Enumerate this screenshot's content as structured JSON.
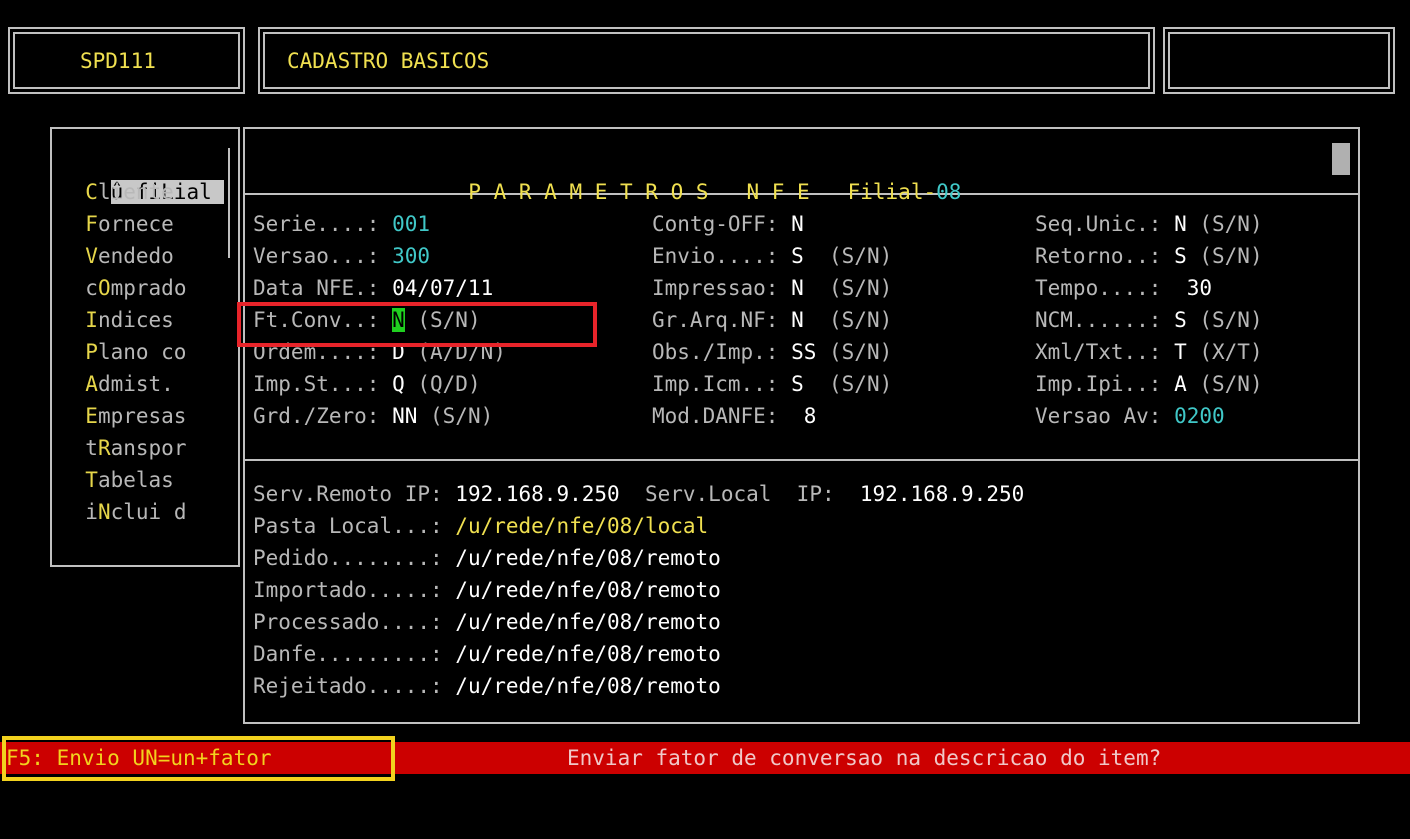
{
  "header": {
    "program_code": "SPD111",
    "title": "CADASTRO BASICOS",
    "right_box": ""
  },
  "menu": {
    "items": [
      {
        "prefix": "û ",
        "hot": "",
        "rest": "fiLial",
        "selected": true
      },
      {
        "prefix": "  ",
        "hot": "C",
        "rest": "liente"
      },
      {
        "prefix": "  ",
        "hot": "F",
        "rest": "ornece"
      },
      {
        "prefix": "  ",
        "hot": "V",
        "rest": "endedo"
      },
      {
        "prefix": "  ",
        "hot": "",
        "rest": "cOmprado"
      },
      {
        "prefix": "  ",
        "hot": "I",
        "rest": "ndices"
      },
      {
        "prefix": "  ",
        "hot": "P",
        "rest": "lano co"
      },
      {
        "prefix": "  ",
        "hot": "A",
        "rest": "dmist."
      },
      {
        "prefix": "  ",
        "hot": "E",
        "rest": "mpresas"
      },
      {
        "prefix": "  ",
        "hot": "",
        "rest": "tRanspor"
      },
      {
        "prefix": "  ",
        "hot": "T",
        "rest": "abelas"
      },
      {
        "prefix": "  ",
        "hot": "",
        "rest": "iNclui d"
      }
    ]
  },
  "panel": {
    "title": "P A R A M E T R O S   N F E",
    "filial_label": "Filial-",
    "filial_value": "08"
  },
  "params": {
    "serie_label": "Serie....: ",
    "serie_value": "001",
    "versao_label": "Versao...: ",
    "versao_value": "300",
    "datanfe_label": "Data NFE.: ",
    "datanfe_value": "04/07/11",
    "ftconv_label": "Ft.Conv..: ",
    "ftconv_value": "N",
    "ftconv_hint": " (S/N)",
    "ordem_label": "Ordem....: ",
    "ordem_value": "D",
    "ordem_hint": " (A/D/N)",
    "impst_label": "Imp.St...: ",
    "impst_value": "Q",
    "impst_hint": " (Q/D)",
    "grdzero_label": "Grd./Zero: ",
    "grdzero_value": "NN",
    "grdzero_hint": " (S/N)",
    "contg_label": "Contg-OFF: ",
    "contg_value": "N",
    "envio_label": "Envio....: ",
    "envio_value": "S",
    "envio_hint": "  (S/N)",
    "impressao_label": "Impressao: ",
    "impressao_value": "N",
    "impressao_hint": "  (S/N)",
    "grarq_label": "Gr.Arq.NF: ",
    "grarq_value": "N",
    "grarq_hint": "  (S/N)",
    "obsimp_label": "Obs./Imp.: ",
    "obsimp_value": "SS",
    "obsimp_hint": " (S/N)",
    "impicm_label": "Imp.Icm..: ",
    "impicm_value": "S",
    "impicm_hint": "  (S/N)",
    "moddanfe_label": "Mod.DANFE:  ",
    "moddanfe_value": "8",
    "sequnic_label": "Seq.Unic.: ",
    "sequnic_value": "N",
    "sequnic_hint": " (S/N)",
    "retorno_label": "Retorno..: ",
    "retorno_value": "S",
    "retorno_hint": " (S/N)",
    "tempo_label": "Tempo....:  ",
    "tempo_value": "30",
    "ncm_label": "NCM......: ",
    "ncm_value": "S",
    "ncm_hint": " (S/N)",
    "xmltxt_label": "Xml/Txt..: ",
    "xmltxt_value": "T",
    "xmltxt_hint": " (X/T)",
    "impipi_label": "Imp.Ipi..: ",
    "impipi_value": "A",
    "impipi_hint": " (S/N)",
    "versaoav_label": "Versao Av: ",
    "versaoav_value": "0200"
  },
  "paths": {
    "serv_remoto_label": "Serv.Remoto IP: ",
    "serv_remoto_value": "192.168.9.250",
    "serv_local_label": "  Serv.Local  IP:  ",
    "serv_local_value": "192.168.9.250",
    "pasta_local_label": "Pasta Local...: ",
    "pasta_local_value": "/u/rede/nfe/08/local",
    "pedido_label": "Pedido........: ",
    "pedido_value": "/u/rede/nfe/08/remoto",
    "importado_label": "Importado.....: ",
    "importado_value": "/u/rede/nfe/08/remoto",
    "processado_label": "Processado....: ",
    "processado_value": "/u/rede/nfe/08/remoto",
    "danfe_label": "Danfe.........: ",
    "danfe_value": "/u/rede/nfe/08/remoto",
    "rejeitado_label": "Rejeitado.....: ",
    "rejeitado_value": "/u/rede/nfe/08/remoto"
  },
  "statusbar": {
    "key_hint": "F5: Envio UN=un+fator",
    "message": "Enviar fator de conversao na descricao do item?"
  },
  "colors": {
    "statusbar_bg": "#cc0000",
    "cursor_bg": "#20d020",
    "highlight_red_box": "#e8242a",
    "highlight_yellow_box": "#f2d21e"
  }
}
